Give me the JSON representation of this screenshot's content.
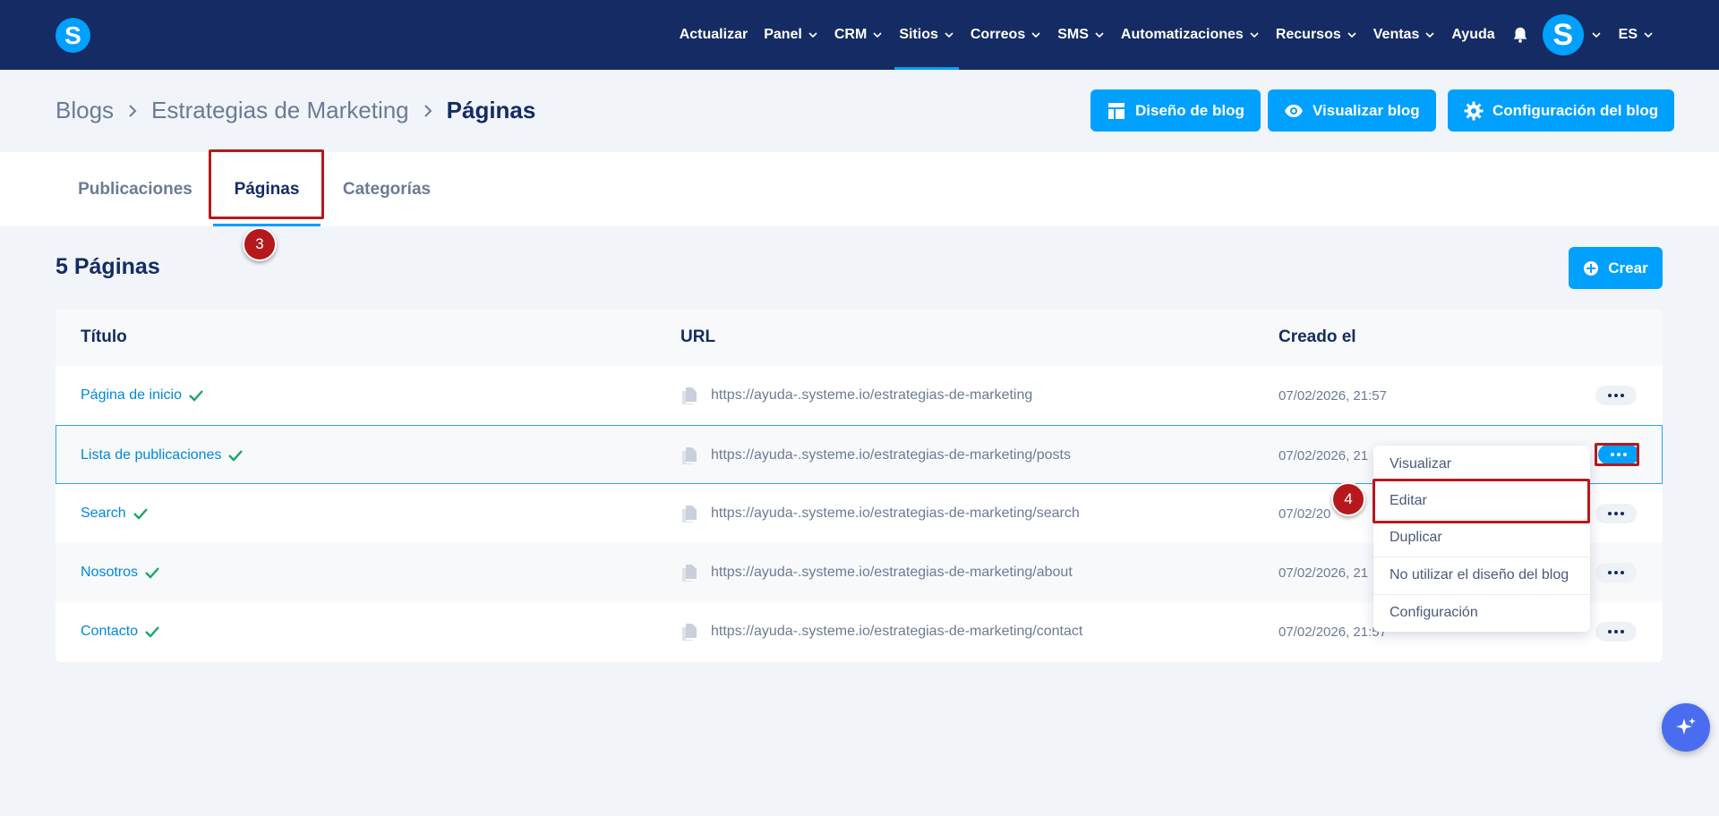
{
  "nav": {
    "logo_letter": "S",
    "items": [
      {
        "label": "Actualizar",
        "dropdown": false
      },
      {
        "label": "Panel",
        "dropdown": true
      },
      {
        "label": "CRM",
        "dropdown": true
      },
      {
        "label": "Sitios",
        "dropdown": true,
        "active": true
      },
      {
        "label": "Correos",
        "dropdown": true
      },
      {
        "label": "SMS",
        "dropdown": true
      },
      {
        "label": "Automatizaciones",
        "dropdown": true
      },
      {
        "label": "Recursos",
        "dropdown": true
      },
      {
        "label": "Ventas",
        "dropdown": true
      },
      {
        "label": "Ayuda",
        "dropdown": false
      }
    ],
    "avatar_letter": "S",
    "language": "ES"
  },
  "breadcrumb": {
    "items": [
      "Blogs",
      "Estrategias de Marketing"
    ],
    "current": "Páginas"
  },
  "header_buttons": {
    "design": "Diseño de blog",
    "view": "Visualizar blog",
    "settings": "Configuración del blog"
  },
  "tabs": [
    {
      "label": "Publicaciones",
      "active": false
    },
    {
      "label": "Páginas",
      "active": true
    },
    {
      "label": "Categorías",
      "active": false
    }
  ],
  "annotations": {
    "step_tab": "3",
    "step_menu": "4"
  },
  "page_count": "5 Páginas",
  "create_button": "Crear",
  "table": {
    "headers": {
      "title": "Título",
      "url": "URL",
      "created": "Creado el"
    },
    "rows": [
      {
        "title": "Página de inicio",
        "url": "https://ayuda-.systeme.io/estrategias-de-marketing",
        "created": "07/02/2026, 21:57"
      },
      {
        "title": "Lista de publicaciones",
        "url": "https://ayuda-.systeme.io/estrategias-de-marketing/posts",
        "created": "07/02/2026, 21"
      },
      {
        "title": "Search",
        "url": "https://ayuda-.systeme.io/estrategias-de-marketing/search",
        "created": "07/02/20"
      },
      {
        "title": "Nosotros",
        "url": "https://ayuda-.systeme.io/estrategias-de-marketing/about",
        "created": "07/02/2026, 21"
      },
      {
        "title": "Contacto",
        "url": "https://ayuda-.systeme.io/estrategias-de-marketing/contact",
        "created": "07/02/2026, 21:57"
      }
    ]
  },
  "row_menu": {
    "items": [
      "Visualizar",
      "Editar",
      "Duplicar",
      "No utilizar el diseño del blog",
      "Configuración"
    ]
  },
  "colors": {
    "navy": "#142c63",
    "accent": "#00a0ff",
    "highlight": "#b5191d",
    "check": "#1aa66a"
  }
}
